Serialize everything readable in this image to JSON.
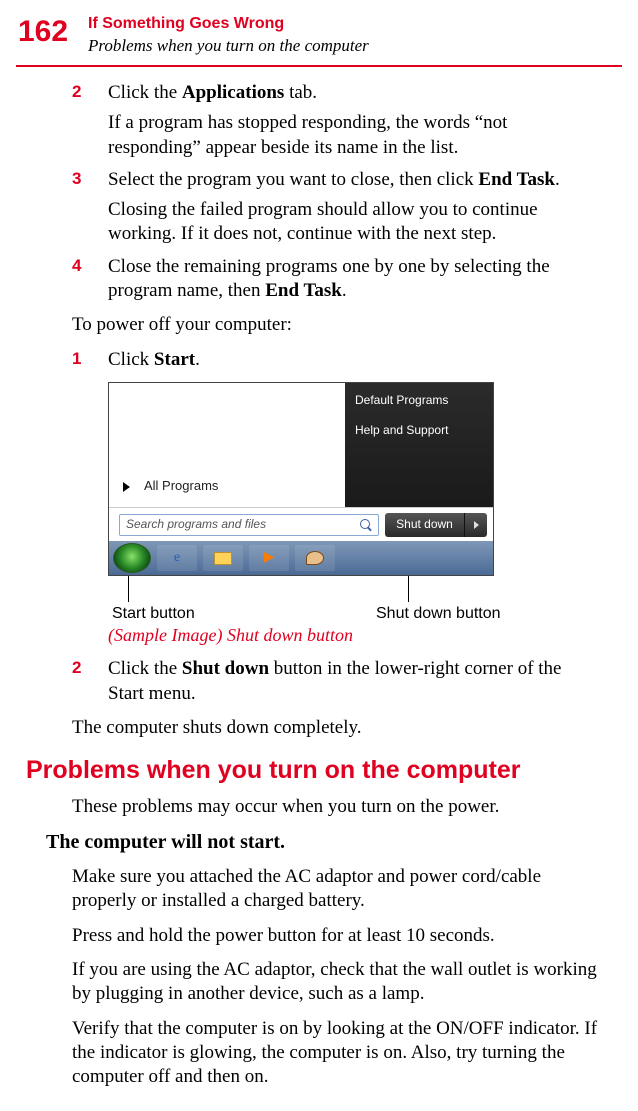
{
  "header": {
    "page_number": "162",
    "chapter": "If Something Goes Wrong",
    "section": "Problems when you turn on the computer"
  },
  "steps_a": [
    {
      "num": "2",
      "body_pre": "Click the ",
      "body_bold": "Applications",
      "body_post": " tab.",
      "follow": "If a program has stopped responding, the words “not responding” appear beside its name in the list."
    },
    {
      "num": "3",
      "body_pre": "Select the program you want to close, then click ",
      "body_bold": "End Task",
      "body_post": ".",
      "follow": "Closing the failed program should allow you to continue working. If it does not, continue with the next step."
    },
    {
      "num": "4",
      "body_pre": "Close the remaining programs one by one by selecting the program name, then ",
      "body_bold": "End Task",
      "body_post": "."
    }
  ],
  "poweroff_intro": "To power off your computer:",
  "poweroff_step1": {
    "num": "1",
    "pre": "Click ",
    "bold": "Start",
    "post": "."
  },
  "win": {
    "right_items": [
      "Default Programs",
      "Help and Support"
    ],
    "all_programs": "All Programs",
    "search_placeholder": "Search programs and files",
    "shutdown_label": "Shut down"
  },
  "callouts": {
    "start": "Start button",
    "shutdown": "Shut down button"
  },
  "caption": "(Sample Image) Shut down button",
  "poweroff_step2": {
    "num": "2",
    "pre": "Click the ",
    "bold": "Shut down",
    "post": " button in the lower-right corner of the Start menu."
  },
  "poweroff_result": "The computer shuts down completely.",
  "big_heading": "Problems when you turn on the computer",
  "intro2": "These problems may occur when you turn on the power.",
  "subhead": "The computer will not start.",
  "paras": [
    "Make sure you attached the AC adaptor and power cord/cable properly or installed a charged battery.",
    "Press and hold the power button for at least 10 seconds.",
    "If you are using the AC adaptor, check that the wall outlet is working by plugging in another device, such as a lamp.",
    "Verify that the computer is on by looking at the ON/OFF indicator. If the indicator is glowing, the computer is on. Also, try turning the computer off and then on."
  ]
}
